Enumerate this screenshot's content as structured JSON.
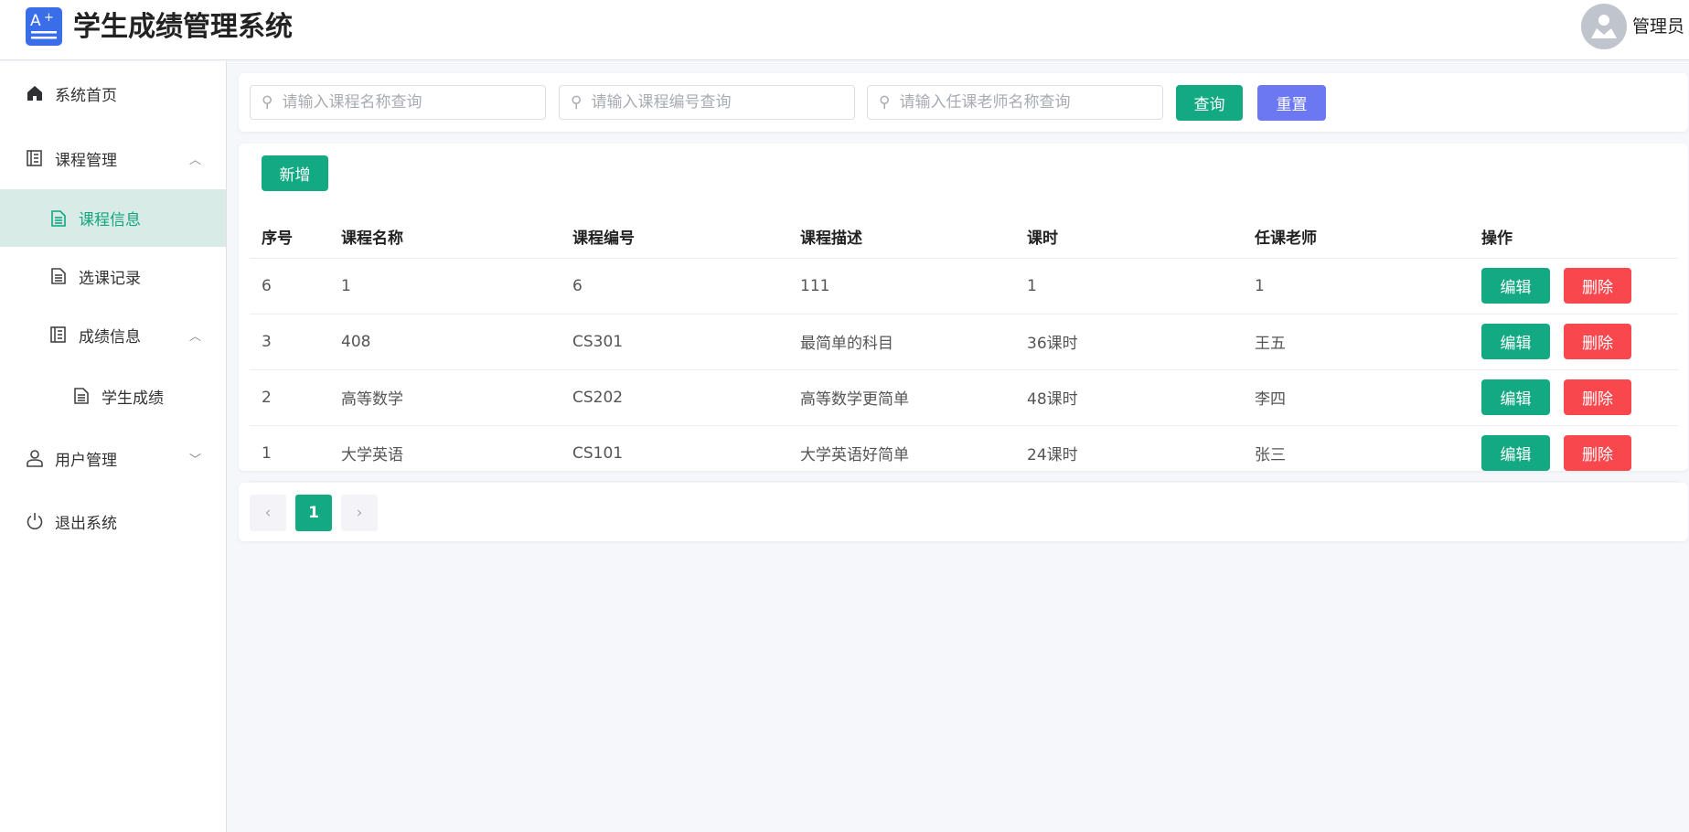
{
  "header": {
    "title": "学生成绩管理系统",
    "user": "管理员"
  },
  "sidebar": {
    "items": [
      {
        "label": "系统首页",
        "icon": "home-icon"
      },
      {
        "label": "课程管理",
        "icon": "notebook-icon",
        "chevron": "up"
      },
      {
        "label": "课程信息",
        "icon": "document-icon",
        "active": true
      },
      {
        "label": "选课记录",
        "icon": "document-icon"
      },
      {
        "label": "成绩信息",
        "icon": "notebook-icon",
        "chevron": "up"
      },
      {
        "label": "学生成绩",
        "icon": "document-icon"
      },
      {
        "label": "用户管理",
        "icon": "user-icon",
        "chevron": "down"
      },
      {
        "label": "退出系统",
        "icon": "power-icon"
      }
    ]
  },
  "search": {
    "course_name_placeholder": "请输入课程名称查询",
    "course_no_placeholder": "请输入课程编号查询",
    "teacher_placeholder": "请输入任课老师名称查询",
    "query_label": "查询",
    "reset_label": "重置"
  },
  "table": {
    "add_label": "新增",
    "columns": [
      "序号",
      "课程名称",
      "课程编号",
      "课程描述",
      "课时",
      "任课老师",
      "操作"
    ],
    "rows": [
      [
        "6",
        "1",
        "6",
        "111",
        "1",
        "1"
      ],
      [
        "3",
        "408",
        "CS301",
        "最简单的科目",
        "36课时",
        "王五"
      ],
      [
        "2",
        "高等数学",
        "CS202",
        "高等数学更简单",
        "48课时",
        "李四"
      ],
      [
        "1",
        "大学英语",
        "CS101",
        "大学英语好简单",
        "24课时",
        "张三"
      ]
    ],
    "edit_label": "编辑",
    "delete_label": "删除"
  },
  "pagination": {
    "current": "1",
    "prev": "‹",
    "next": "›"
  },
  "colors": {
    "primary": "#13a983",
    "reset": "#6c77f2",
    "danger": "#f8484e"
  }
}
